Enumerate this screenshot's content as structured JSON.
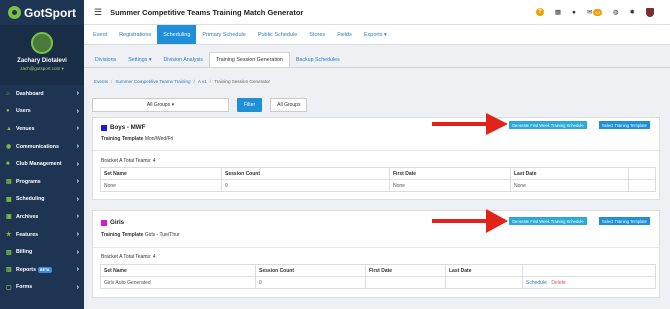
{
  "app": {
    "logo_text": "GotSport",
    "page_title": "Summer Competitive Teams Training Match Generator"
  },
  "user": {
    "name": "Zachary Diotalevi",
    "email": "zach@gotsport.com ▾"
  },
  "topbar": {
    "help": "?",
    "notif_count": "12"
  },
  "sidebar": {
    "items": [
      {
        "label": "Dashboard",
        "icon": "⌂"
      },
      {
        "label": "Users",
        "icon": "●"
      },
      {
        "label": "Venues",
        "icon": "▲"
      },
      {
        "label": "Communications",
        "icon": "◉"
      },
      {
        "label": "Club Management",
        "icon": "■"
      },
      {
        "label": "Programs",
        "icon": "▤"
      },
      {
        "label": "Scheduling",
        "icon": "▦"
      },
      {
        "label": "Archives",
        "icon": "▣"
      },
      {
        "label": "Features",
        "icon": "★"
      },
      {
        "label": "Billing",
        "icon": "▧"
      },
      {
        "label": "Reports",
        "icon": "▥",
        "badge": "BETA"
      },
      {
        "label": "Forms",
        "icon": "▢"
      }
    ]
  },
  "tabs1": [
    "Event",
    "Registrations",
    "Scheduling",
    "Primary Schedule",
    "Public Schedule",
    "Stores",
    "Fields",
    "Exports ▾"
  ],
  "tabs2": [
    "Divisions",
    "Settings ▾",
    "Division Analysis",
    "Training Session Generation",
    "Backup Schedules"
  ],
  "breadcrumb": [
    "Events",
    "Summer Competitive Teams Training",
    "A v1",
    "Training Session Generator"
  ],
  "filter": {
    "group_select": "All Groups ▾",
    "filter_label": "Filter",
    "all_groups_label": "All Groups"
  },
  "buttons": {
    "generate": "Generate First Week Training Schedule",
    "select_template": "Select Training Template"
  },
  "cards": [
    {
      "title": "Boys - MWF",
      "color": "#1a1ad6",
      "template_label": "Training Template",
      "template_value": "Mon/Wed/Fri",
      "bracket": "Bracket A Total Teams: 4",
      "headers": [
        "Set Name",
        "Session Count",
        "First Date",
        "Last Date",
        ""
      ],
      "row": [
        "None",
        "0",
        "None",
        "None",
        ""
      ]
    },
    {
      "title": "Girls",
      "color": "#d61ad0",
      "template_label": "Training Template",
      "template_value": "Girls - Tue/Thur",
      "bracket": "Bracket A Total Teams: 4",
      "headers": [
        "Set Name",
        "Session Count",
        "First Date",
        "Last Date",
        ""
      ],
      "row": [
        "Girls Auto Generated",
        "0",
        "",
        "",
        ""
      ],
      "actions": {
        "schedule": "Schedule",
        "sep": " · ",
        "delete": "Delete"
      }
    }
  ]
}
